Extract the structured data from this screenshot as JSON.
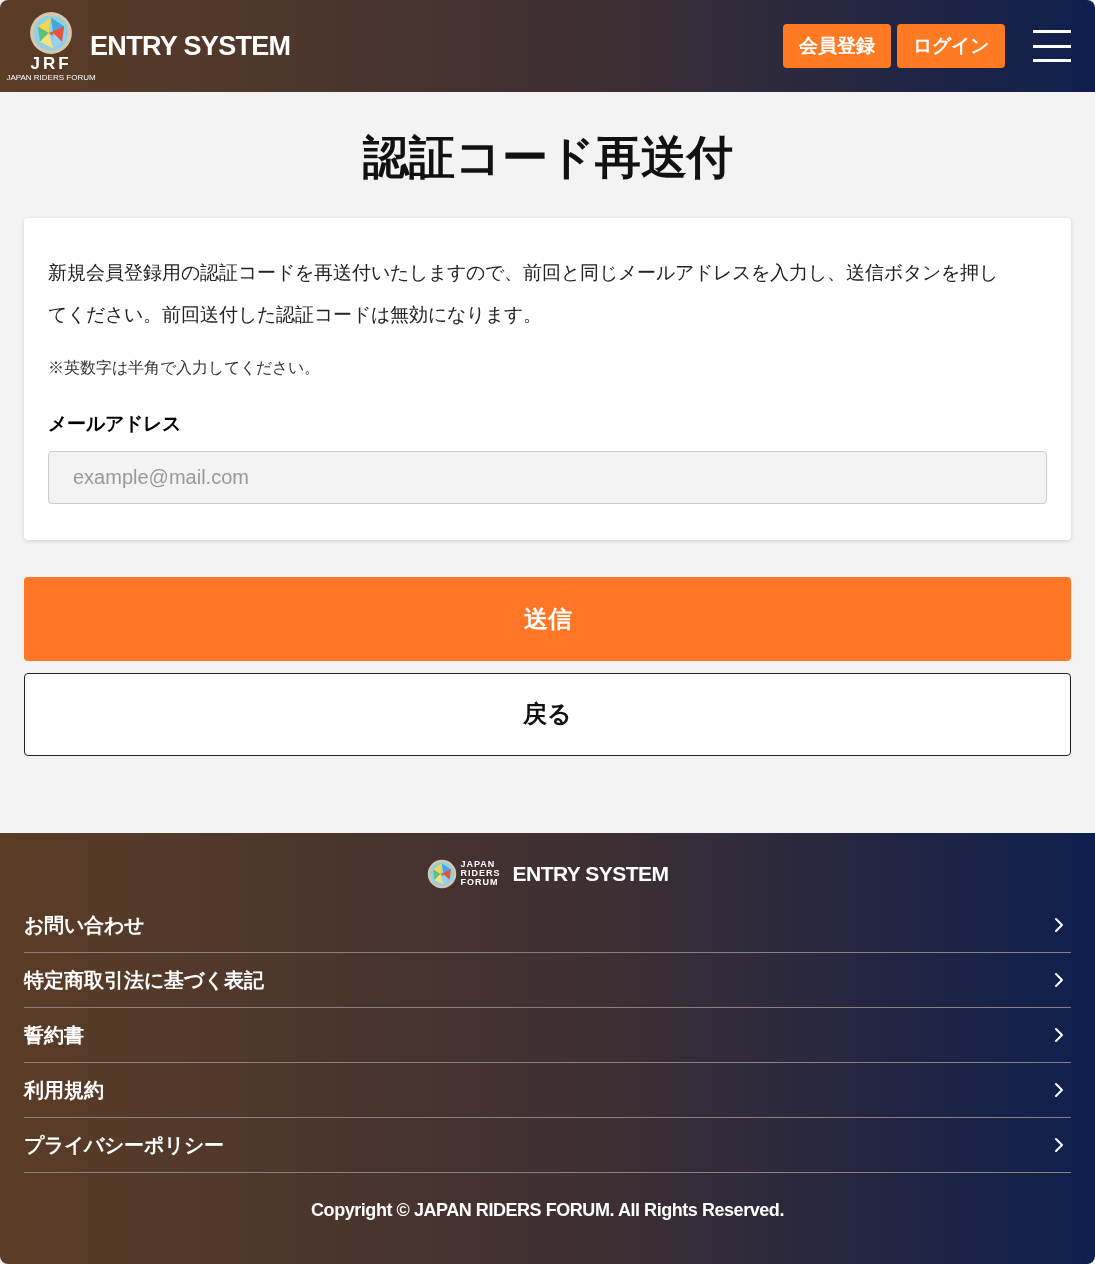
{
  "header": {
    "logo_mark": "JRF",
    "logo_subtitle": "JAPAN RIDERS FORUM",
    "title": "ENTRY SYSTEM",
    "buttons": [
      "会員登録",
      "ログイン"
    ]
  },
  "page_title": "認証コード再送付",
  "card": {
    "description": "新規会員登録用の認証コードを再送付いたしますので、前回と同じメールアドレスを入力し、送信ボタンを押してください。前回送付した認証コードは無効になります。",
    "note": "※英数字は半角で入力してください。",
    "field_label": "メールアドレス",
    "placeholder": "example@mail.com"
  },
  "submit_button": "送信",
  "back_button": "戻る",
  "footer": {
    "logo_lines": [
      "JAPAN",
      "RIDERS",
      "FORUM"
    ],
    "title": "ENTRY SYSTEM",
    "links": [
      "お問い合わせ",
      "特定商取引法に基づく表記",
      "誓約書",
      "利用規約",
      "プライバシーポリシー"
    ],
    "copyright": "Copyright © JAPAN RIDERS FORUM. All Rights Reserved."
  }
}
